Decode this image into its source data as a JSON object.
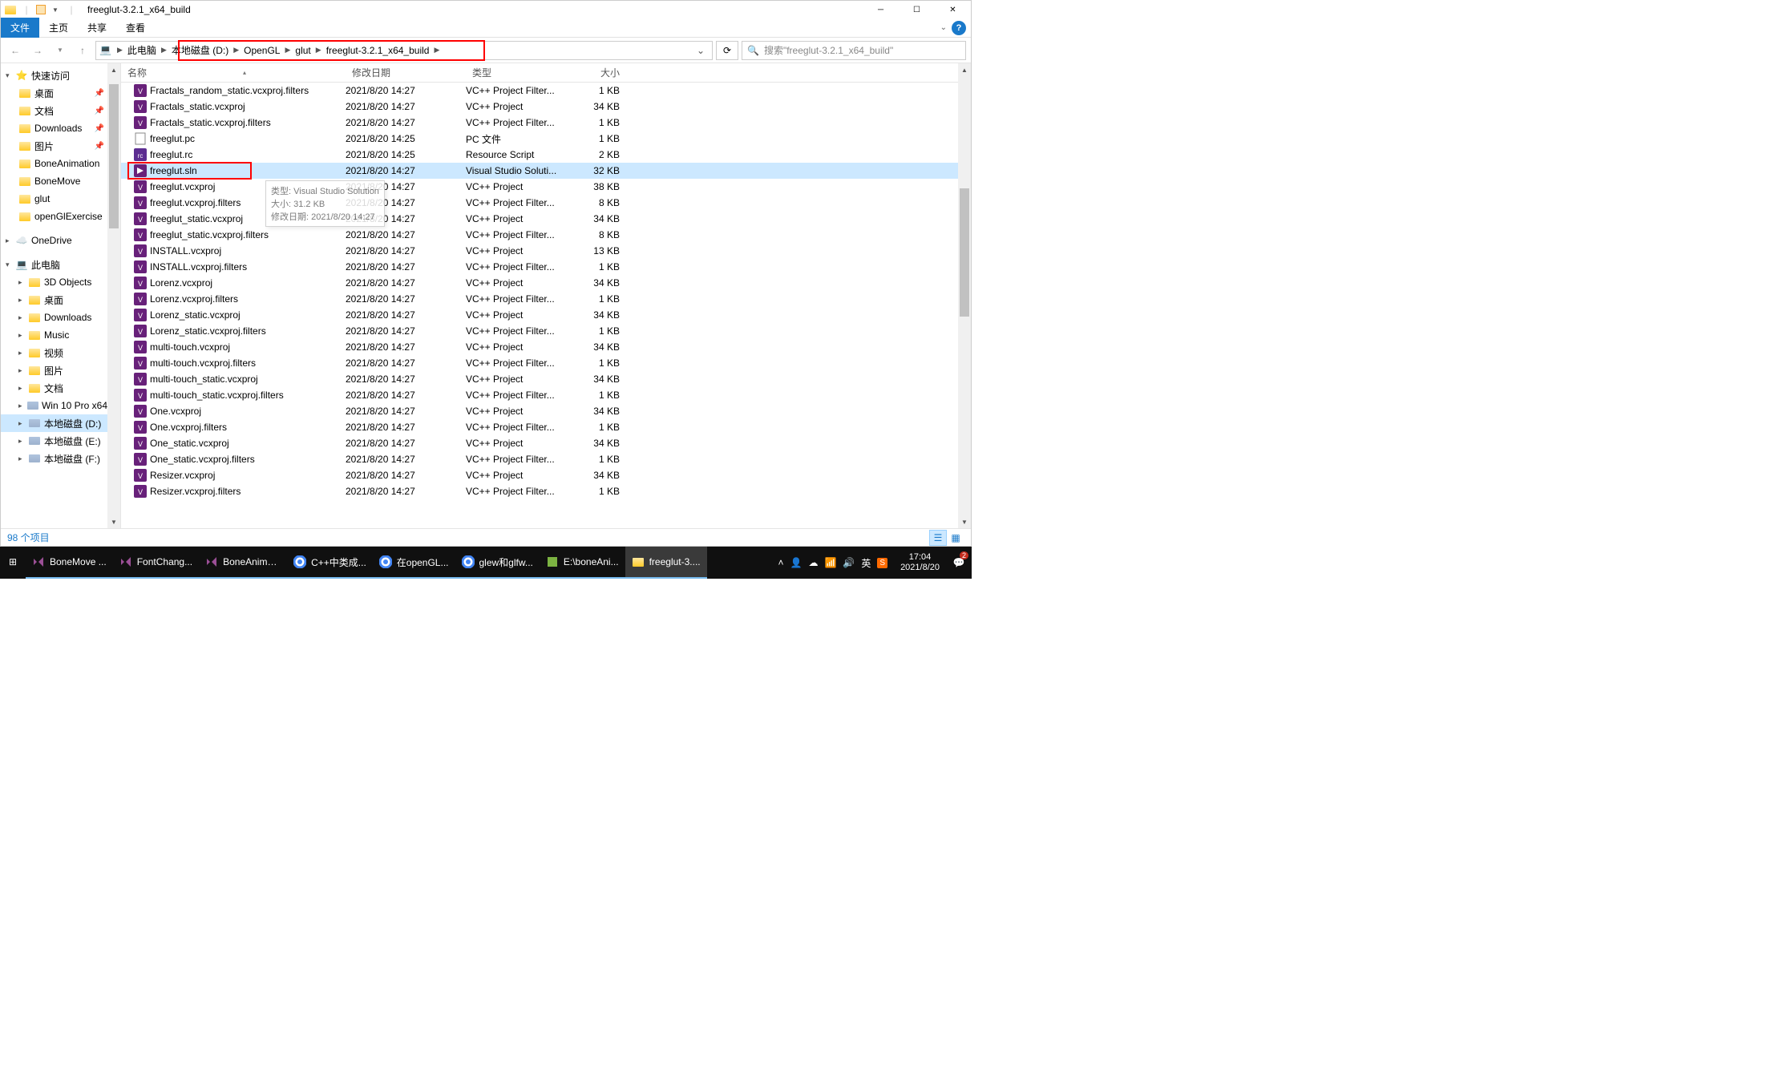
{
  "window": {
    "title": "freeglut-3.2.1_x64_build"
  },
  "ribbon": {
    "file": "文件",
    "home": "主页",
    "share": "共享",
    "view": "查看"
  },
  "breadcrumb": {
    "segments": [
      "此电脑",
      "本地磁盘 (D:)",
      "OpenGL",
      "glut",
      "freeglut-3.2.1_x64_build"
    ]
  },
  "search": {
    "placeholder": "搜索\"freeglut-3.2.1_x64_build\""
  },
  "sidebar": {
    "quick": "快速访问",
    "quick_items": [
      {
        "label": "桌面",
        "pin": true
      },
      {
        "label": "文档",
        "pin": true
      },
      {
        "label": "Downloads",
        "pin": true
      },
      {
        "label": "图片",
        "pin": true
      },
      {
        "label": "BoneAnimation",
        "pin": false
      },
      {
        "label": "BoneMove",
        "pin": false
      },
      {
        "label": "glut",
        "pin": false
      },
      {
        "label": "openGlExercise",
        "pin": false
      }
    ],
    "onedrive": "OneDrive",
    "thispc": "此电脑",
    "pc_items": [
      {
        "label": "3D Objects",
        "type": "3d"
      },
      {
        "label": "桌面",
        "type": "desktop"
      },
      {
        "label": "Downloads",
        "type": "downloads"
      },
      {
        "label": "Music",
        "type": "music"
      },
      {
        "label": "视频",
        "type": "video"
      },
      {
        "label": "图片",
        "type": "pictures"
      },
      {
        "label": "文档",
        "type": "documents"
      },
      {
        "label": "Win 10 Pro x64",
        "type": "disk"
      },
      {
        "label": "本地磁盘 (D:)",
        "type": "disk",
        "selected": true
      },
      {
        "label": "本地磁盘 (E:)",
        "type": "disk"
      },
      {
        "label": "本地磁盘 (F:)",
        "type": "disk"
      }
    ]
  },
  "columns": {
    "name": "名称",
    "date": "修改日期",
    "type": "类型",
    "size": "大小"
  },
  "files": [
    {
      "name": "Fractals_random_static.vcxproj.filters",
      "date": "2021/8/20 14:27",
      "type": "VC++ Project Filter...",
      "size": "1 KB",
      "icon": "vcx"
    },
    {
      "name": "Fractals_static.vcxproj",
      "date": "2021/8/20 14:27",
      "type": "VC++ Project",
      "size": "34 KB",
      "icon": "vcx"
    },
    {
      "name": "Fractals_static.vcxproj.filters",
      "date": "2021/8/20 14:27",
      "type": "VC++ Project Filter...",
      "size": "1 KB",
      "icon": "vcx"
    },
    {
      "name": "freeglut.pc",
      "date": "2021/8/20 14:25",
      "type": "PC 文件",
      "size": "1 KB",
      "icon": "doc"
    },
    {
      "name": "freeglut.rc",
      "date": "2021/8/20 14:25",
      "type": "Resource Script",
      "size": "2 KB",
      "icon": "rc"
    },
    {
      "name": "freeglut.sln",
      "date": "2021/8/20 14:27",
      "type": "Visual Studio Soluti...",
      "size": "32 KB",
      "icon": "sln",
      "selected": true,
      "highlight": true
    },
    {
      "name": "freeglut.vcxproj",
      "date": "2021/8/20 14:27",
      "type": "VC++ Project",
      "size": "38 KB",
      "icon": "vcx"
    },
    {
      "name": "freeglut.vcxproj.filters",
      "date": "2021/8/20 14:27",
      "type": "VC++ Project Filter...",
      "size": "8 KB",
      "icon": "vcx"
    },
    {
      "name": "freeglut_static.vcxproj",
      "date": "2021/8/20 14:27",
      "type": "VC++ Project",
      "size": "34 KB",
      "icon": "vcx"
    },
    {
      "name": "freeglut_static.vcxproj.filters",
      "date": "2021/8/20 14:27",
      "type": "VC++ Project Filter...",
      "size": "8 KB",
      "icon": "vcx"
    },
    {
      "name": "INSTALL.vcxproj",
      "date": "2021/8/20 14:27",
      "type": "VC++ Project",
      "size": "13 KB",
      "icon": "vcx"
    },
    {
      "name": "INSTALL.vcxproj.filters",
      "date": "2021/8/20 14:27",
      "type": "VC++ Project Filter...",
      "size": "1 KB",
      "icon": "vcx"
    },
    {
      "name": "Lorenz.vcxproj",
      "date": "2021/8/20 14:27",
      "type": "VC++ Project",
      "size": "34 KB",
      "icon": "vcx"
    },
    {
      "name": "Lorenz.vcxproj.filters",
      "date": "2021/8/20 14:27",
      "type": "VC++ Project Filter...",
      "size": "1 KB",
      "icon": "vcx"
    },
    {
      "name": "Lorenz_static.vcxproj",
      "date": "2021/8/20 14:27",
      "type": "VC++ Project",
      "size": "34 KB",
      "icon": "vcx"
    },
    {
      "name": "Lorenz_static.vcxproj.filters",
      "date": "2021/8/20 14:27",
      "type": "VC++ Project Filter...",
      "size": "1 KB",
      "icon": "vcx"
    },
    {
      "name": "multi-touch.vcxproj",
      "date": "2021/8/20 14:27",
      "type": "VC++ Project",
      "size": "34 KB",
      "icon": "vcx"
    },
    {
      "name": "multi-touch.vcxproj.filters",
      "date": "2021/8/20 14:27",
      "type": "VC++ Project Filter...",
      "size": "1 KB",
      "icon": "vcx"
    },
    {
      "name": "multi-touch_static.vcxproj",
      "date": "2021/8/20 14:27",
      "type": "VC++ Project",
      "size": "34 KB",
      "icon": "vcx"
    },
    {
      "name": "multi-touch_static.vcxproj.filters",
      "date": "2021/8/20 14:27",
      "type": "VC++ Project Filter...",
      "size": "1 KB",
      "icon": "vcx"
    },
    {
      "name": "One.vcxproj",
      "date": "2021/8/20 14:27",
      "type": "VC++ Project",
      "size": "34 KB",
      "icon": "vcx"
    },
    {
      "name": "One.vcxproj.filters",
      "date": "2021/8/20 14:27",
      "type": "VC++ Project Filter...",
      "size": "1 KB",
      "icon": "vcx"
    },
    {
      "name": "One_static.vcxproj",
      "date": "2021/8/20 14:27",
      "type": "VC++ Project",
      "size": "34 KB",
      "icon": "vcx"
    },
    {
      "name": "One_static.vcxproj.filters",
      "date": "2021/8/20 14:27",
      "type": "VC++ Project Filter...",
      "size": "1 KB",
      "icon": "vcx"
    },
    {
      "name": "Resizer.vcxproj",
      "date": "2021/8/20 14:27",
      "type": "VC++ Project",
      "size": "34 KB",
      "icon": "vcx"
    },
    {
      "name": "Resizer.vcxproj.filters",
      "date": "2021/8/20 14:27",
      "type": "VC++ Project Filter...",
      "size": "1 KB",
      "icon": "vcx"
    }
  ],
  "tooltip": {
    "line1": "类型: Visual Studio Solution",
    "line2": "大小: 31.2 KB",
    "line3": "修改日期: 2021/8/20 14:27"
  },
  "status": {
    "items": "98 个项目"
  },
  "taskbar": {
    "items": [
      {
        "label": "BoneMove ...",
        "icon": "vs"
      },
      {
        "label": "FontChang...",
        "icon": "vs"
      },
      {
        "label": "BoneAnima...",
        "icon": "vs"
      },
      {
        "label": "C++中类成...",
        "icon": "chrome"
      },
      {
        "label": "在openGL...",
        "icon": "chrome"
      },
      {
        "label": "glew和glfw...",
        "icon": "chrome"
      },
      {
        "label": "E:\\boneAni...",
        "icon": "notepad"
      },
      {
        "label": "freeglut-3....",
        "icon": "explorer",
        "active": true
      }
    ],
    "ime": "英",
    "time": "17:04",
    "date": "2021/8/20",
    "badge": "2"
  }
}
